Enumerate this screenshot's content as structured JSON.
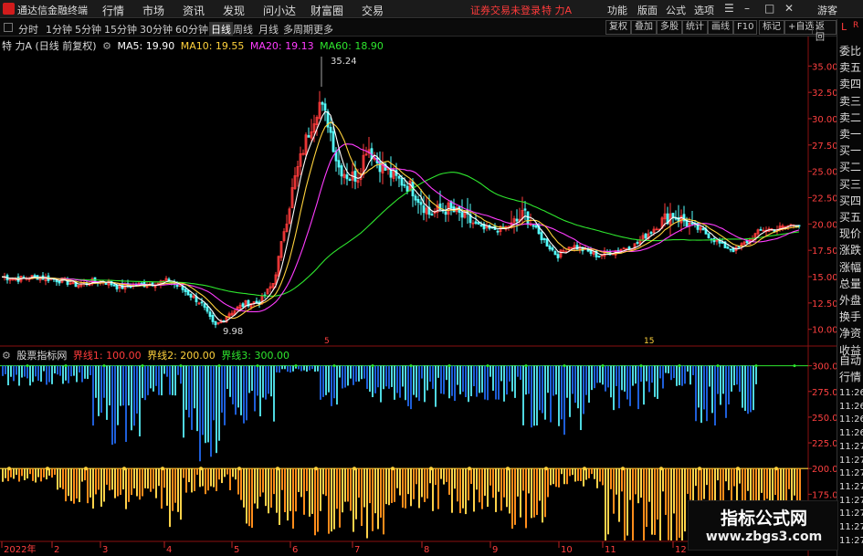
{
  "app": {
    "name": "通达信金融终端",
    "status": "证券交易未登录",
    "stock_title": "特 力A"
  },
  "menu": [
    {
      "label": "行情"
    },
    {
      "label": "市场"
    },
    {
      "label": "资讯"
    },
    {
      "label": "发现"
    },
    {
      "label": "问小达"
    },
    {
      "label": "财富圈"
    },
    {
      "label": "交易"
    }
  ],
  "right_menu": [
    {
      "label": "功能"
    },
    {
      "label": "版面"
    },
    {
      "label": "公式"
    },
    {
      "label": "选项"
    },
    {
      "label": "游客"
    }
  ],
  "timeframes": [
    {
      "label": "分时"
    },
    {
      "label": "1分钟"
    },
    {
      "label": "5分钟"
    },
    {
      "label": "15分钟"
    },
    {
      "label": "30分钟"
    },
    {
      "label": "60分钟"
    },
    {
      "label": "日线",
      "active": true
    },
    {
      "label": "周线"
    },
    {
      "label": "月线"
    },
    {
      "label": "多周期"
    },
    {
      "label": "更多"
    }
  ],
  "toolbar_buttons": [
    {
      "label": "复权"
    },
    {
      "label": "叠加"
    },
    {
      "label": "多股"
    },
    {
      "label": "统计"
    },
    {
      "label": "画线"
    },
    {
      "label": "F10"
    },
    {
      "label": "标记"
    },
    {
      "label": "+自选"
    },
    {
      "label": "返回"
    }
  ],
  "main_legend": {
    "title": "特 力A (日线 前复权)",
    "ma5": "MA5: 19.90",
    "ma10": "MA10: 19.55",
    "ma20": "MA20: 19.13",
    "ma60": "MA60: 18.90"
  },
  "indicator_legend": {
    "name": "股票指标网",
    "l1": "界线1: 100.00",
    "l2": "界线2: 200.00",
    "l3": "界线3: 300.00"
  },
  "annotations": {
    "high": "35.24",
    "low": "9.98",
    "mark1": "5",
    "mark2": "15"
  },
  "price_axis": [
    "35.00",
    "32.50",
    "30.00",
    "27.50",
    "25.00",
    "22.50",
    "20.00",
    "17.50",
    "15.00",
    "12.50",
    "10.00"
  ],
  "ind_axis": [
    "300.0",
    "275.0",
    "250.0",
    "225.0",
    "200.0",
    "175.0",
    "150.0"
  ],
  "time_axis": [
    "2022年",
    "2",
    "3",
    "4",
    "5",
    "6",
    "7",
    "8",
    "9",
    "10",
    "11",
    "12"
  ],
  "right_panel": {
    "quote_labels": [
      "委比",
      "卖五",
      "卖四",
      "卖三",
      "卖二",
      "卖一",
      "买一",
      "买二",
      "买三",
      "买四",
      "买五",
      "现价",
      "涨跌",
      "涨幅",
      "总量",
      "外盘",
      "换手",
      "净资",
      "收益"
    ],
    "tabs": [
      "自动",
      "行情"
    ],
    "times": [
      "11:26",
      "11:26",
      "11:26",
      "11:26",
      "11:27",
      "11:27",
      "11:27",
      "11:27",
      "11:27",
      "11:27",
      "11:27",
      "11:27"
    ]
  },
  "watermark": {
    "line1": "指标公式网",
    "line2": "www.zbgs3.com"
  },
  "colors": {
    "up": "#ff3b3b",
    "down": "#54ffff",
    "ma5": "#ffffff",
    "ma10": "#ffd23c",
    "ma20": "#ff3cff",
    "ma60": "#2ee62e",
    "bar_cyan": "#4fd8e0",
    "bar_blue": "#1e5ed8",
    "bar_orange": "#ff8c1a",
    "bar_yellow": "#ffd24a"
  }
}
